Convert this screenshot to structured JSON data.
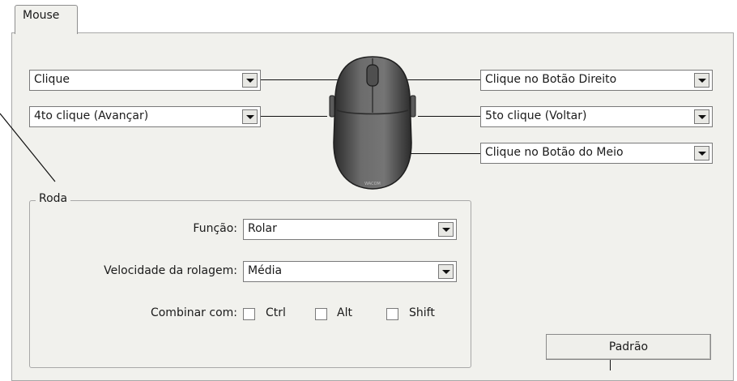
{
  "tab": {
    "label": "Mouse"
  },
  "buttons": {
    "left": "Clique",
    "side_front": "4to clique (Avançar)",
    "right": "Clique no Botão Direito",
    "side_back": "5to clique (Voltar)",
    "middle": "Clique no Botão do Meio"
  },
  "mouse_logo": "WACOM",
  "wheel": {
    "legend": "Roda",
    "function_label": "Função:",
    "function_value": "Rolar",
    "speed_label": "Velocidade da rolagem:",
    "speed_value": "Média",
    "combine_label": "Combinar com:",
    "modifiers": [
      {
        "label": "Ctrl",
        "checked": false
      },
      {
        "label": "Alt",
        "checked": false
      },
      {
        "label": "Shift",
        "checked": false
      }
    ]
  },
  "default_button": "Padrão"
}
